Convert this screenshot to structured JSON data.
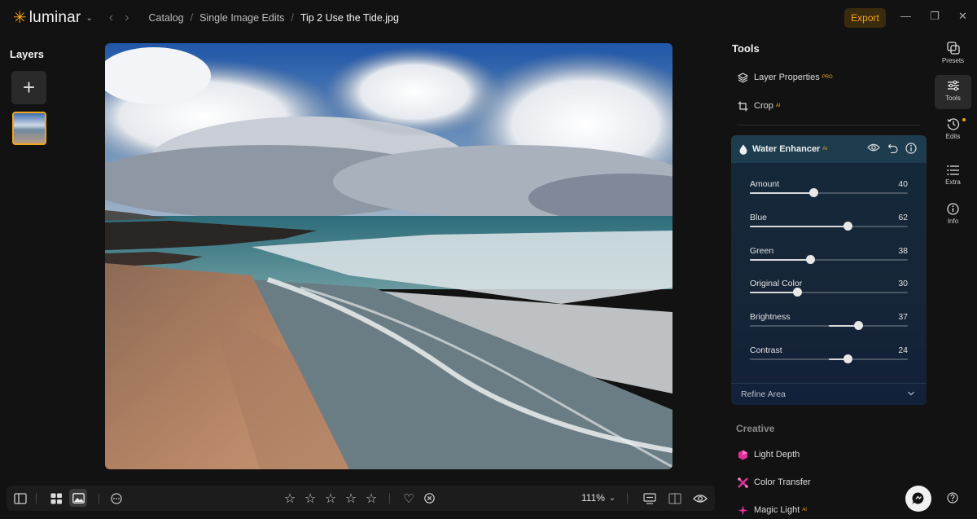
{
  "app": {
    "name": "luminar"
  },
  "breadcrumb": [
    "Catalog",
    "Single Image Edits",
    "Tip 2 Use the Tide.jpg"
  ],
  "export_label": "Export",
  "layers": {
    "title": "Layers"
  },
  "tools": {
    "title": "Tools",
    "items": [
      {
        "label": "Layer Properties",
        "badge": "PRO"
      },
      {
        "label": "Crop",
        "badge": "AI"
      }
    ]
  },
  "water_enhancer": {
    "title": "Water Enhancer",
    "badge": "AI",
    "sliders": [
      {
        "label": "Amount",
        "value": "40",
        "fraction": 0.4,
        "bipolar": false
      },
      {
        "label": "Blue",
        "value": "62",
        "fraction": 0.62,
        "bipolar": false
      },
      {
        "label": "Green",
        "value": "38",
        "fraction": 0.38,
        "bipolar": false
      },
      {
        "label": "Original Color",
        "value": "30",
        "fraction": 0.3,
        "bipolar": false
      },
      {
        "label": "Brightness",
        "value": "37",
        "fraction": 0.37,
        "bipolar": true
      },
      {
        "label": "Contrast",
        "value": "24",
        "fraction": 0.24,
        "bipolar": true
      }
    ],
    "refine_label": "Refine Area"
  },
  "creative": {
    "title": "Creative",
    "items": [
      {
        "label": "Light Depth",
        "badge": ""
      },
      {
        "label": "Color Transfer",
        "badge": ""
      },
      {
        "label": "Magic Light",
        "badge": "AI"
      }
    ]
  },
  "rail": [
    "Presets",
    "Tools",
    "Edits",
    "Extra",
    "Info"
  ],
  "zoom": "111%",
  "colors": {
    "accent": "#f4a51c",
    "panel": "#14293a",
    "background": "#121212"
  }
}
